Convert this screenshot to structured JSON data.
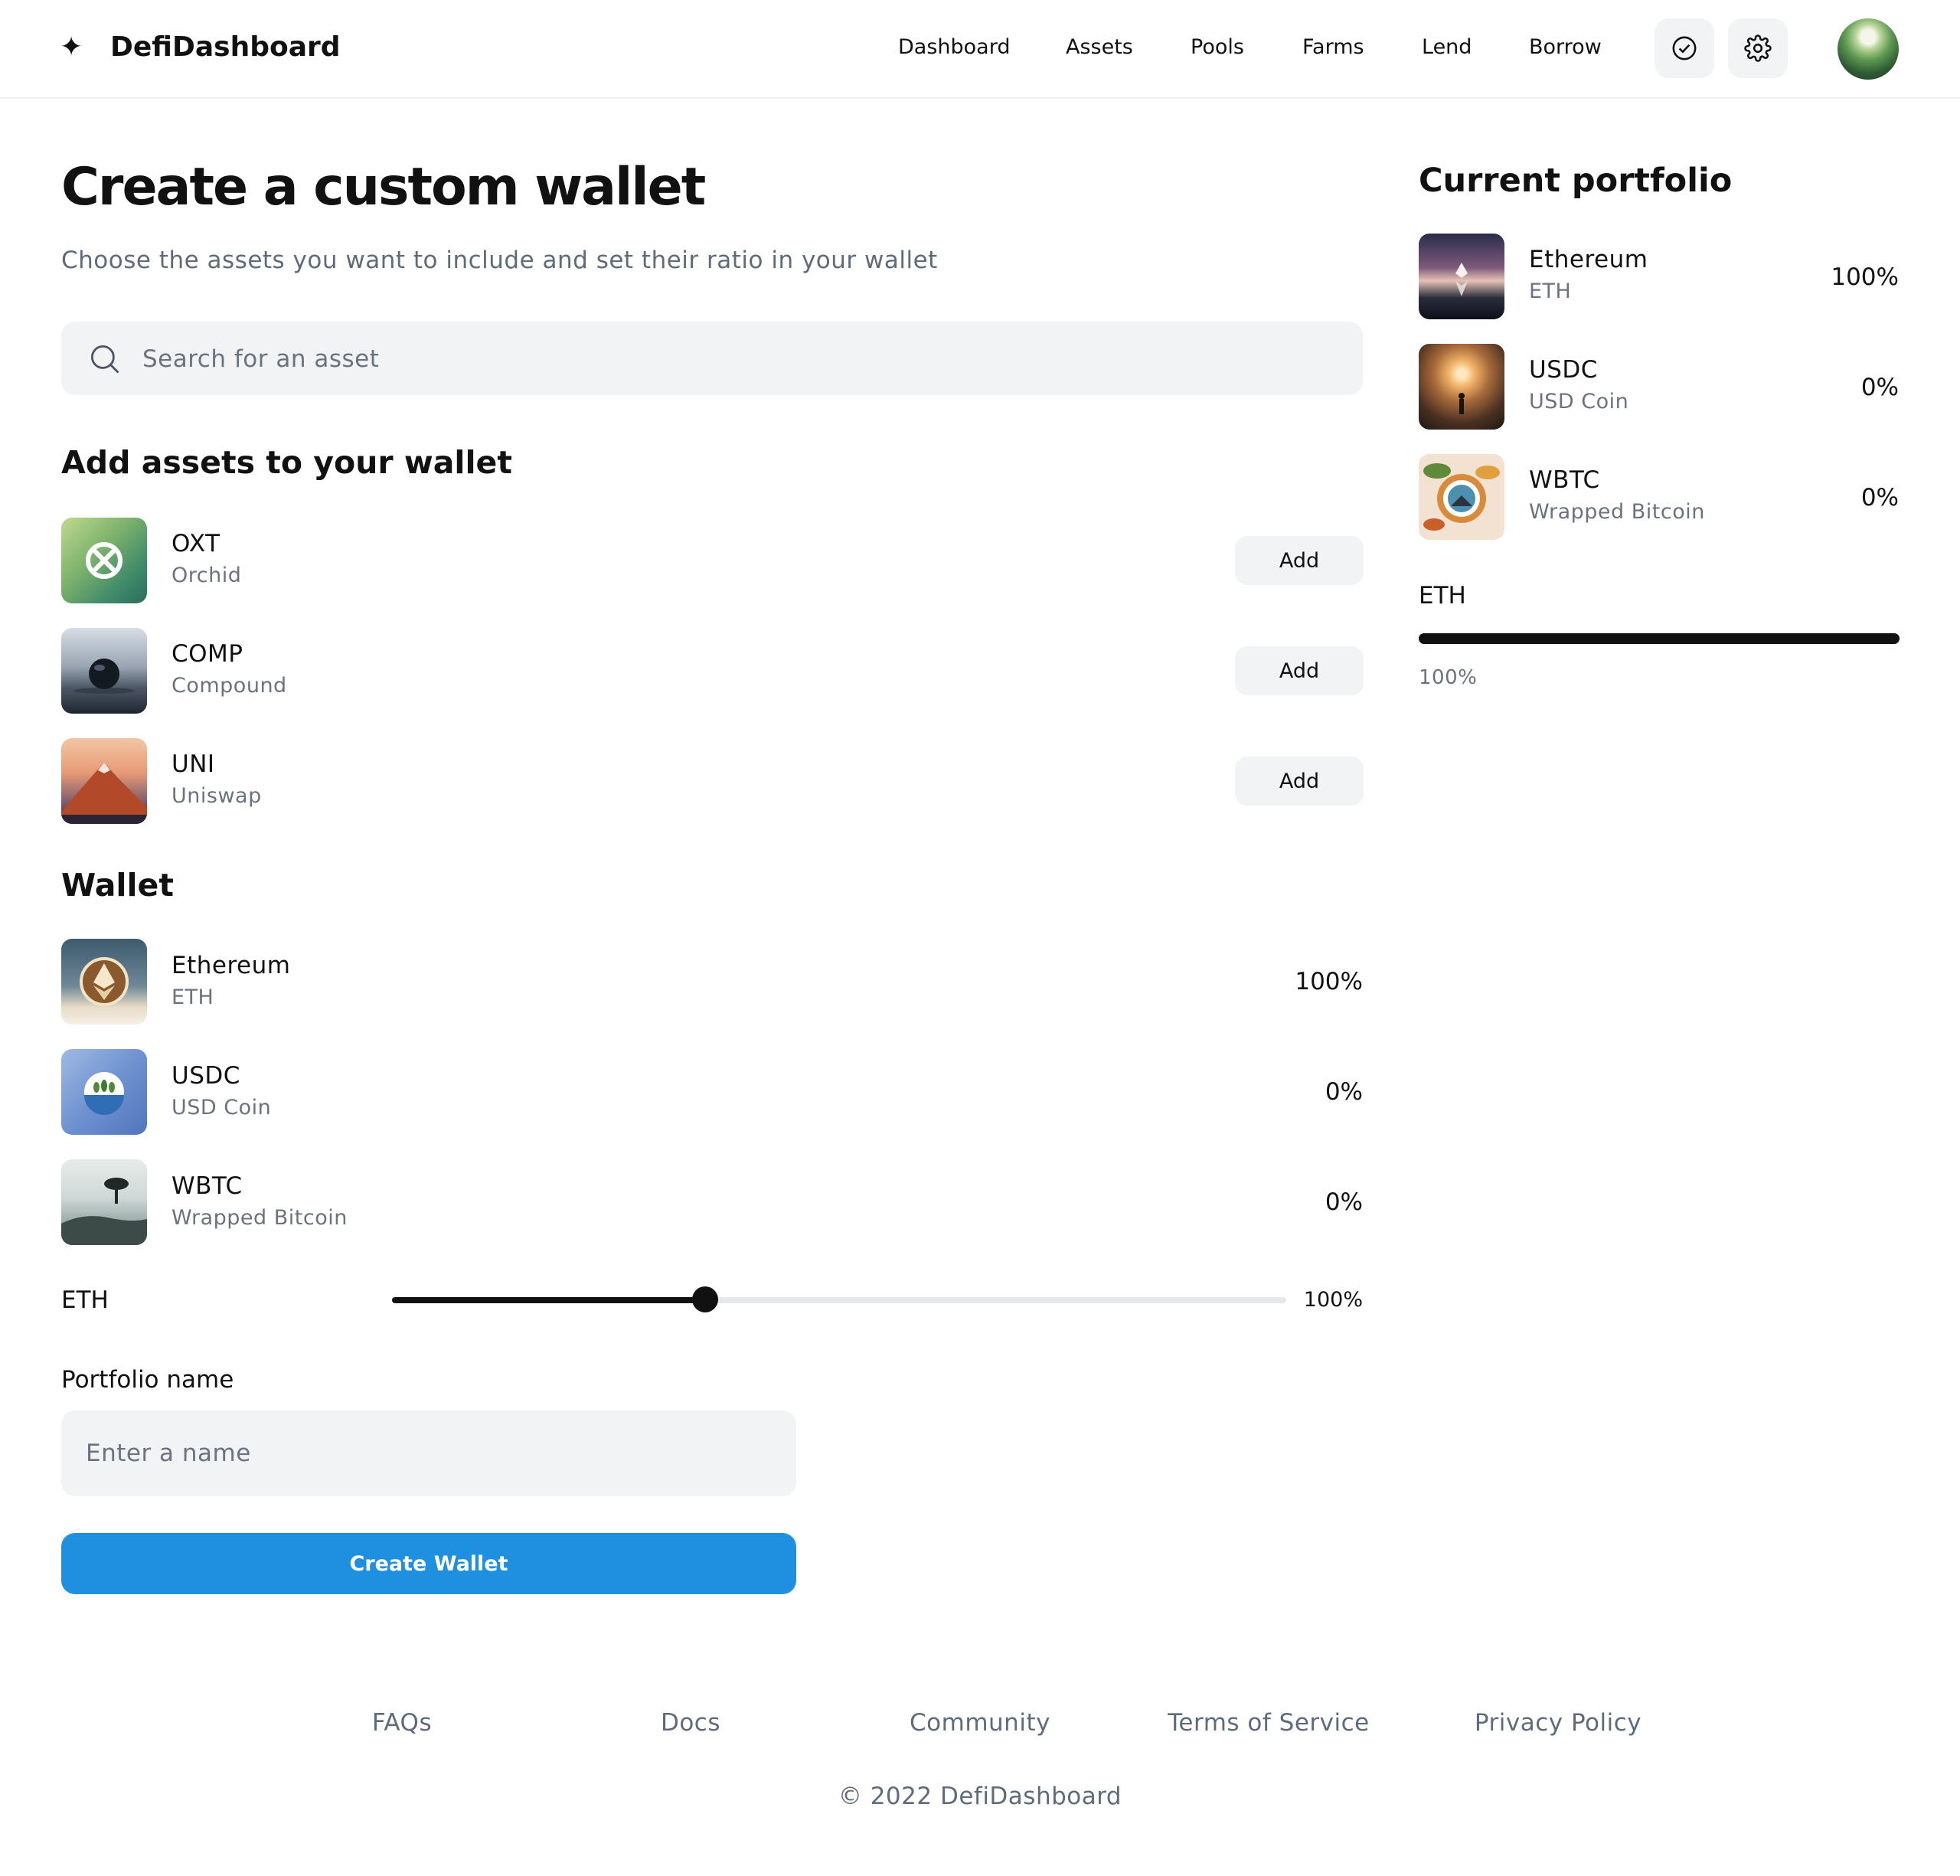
{
  "header": {
    "brand_icon": "✦",
    "brand_name": "DefiDashboard",
    "nav": [
      "Dashboard",
      "Assets",
      "Pools",
      "Farms",
      "Lend",
      "Borrow"
    ],
    "icons": [
      "check-circle-icon",
      "gear-icon"
    ]
  },
  "main": {
    "title": "Create a custom wallet",
    "subtitle": "Choose the assets you want to include and set their ratio in your wallet",
    "search": {
      "placeholder": "Search for an asset",
      "value": ""
    },
    "add_section_title": "Add assets to your wallet",
    "available_assets": [
      {
        "symbol": "OXT",
        "name": "Orchid",
        "button": "Add"
      },
      {
        "symbol": "COMP",
        "name": "Compound",
        "button": "Add"
      },
      {
        "symbol": "UNI",
        "name": "Uniswap",
        "button": "Add"
      }
    ],
    "wallet_title": "Wallet",
    "wallet_assets": [
      {
        "name": "Ethereum",
        "symbol": "ETH",
        "pct": "100%"
      },
      {
        "name": "USDC",
        "symbol": "USD Coin",
        "pct": "0%"
      },
      {
        "name": "WBTC",
        "symbol": "Wrapped Bitcoin",
        "pct": "0%"
      }
    ],
    "slider": {
      "label": "ETH",
      "value_text": "100%",
      "position_fraction": 0.35
    },
    "portfolio_name_label": "Portfolio name",
    "portfolio_name_placeholder": "Enter a name",
    "portfolio_name_value": "",
    "create_button": "Create Wallet",
    "accent_color": "#1f8fdf"
  },
  "sidebar": {
    "title": "Current portfolio",
    "assets": [
      {
        "name": "Ethereum",
        "symbol": "ETH",
        "pct": "100%"
      },
      {
        "name": "USDC",
        "symbol": "USD Coin",
        "pct": "0%"
      },
      {
        "name": "WBTC",
        "symbol": "Wrapped Bitcoin",
        "pct": "0%"
      }
    ],
    "allocation": {
      "label": "ETH",
      "value_text": "100%",
      "fraction": 1.0
    }
  },
  "footer": {
    "links": [
      "FAQs",
      "Docs",
      "Community",
      "Terms of Service",
      "Privacy Policy"
    ],
    "copyright": "© 2022 DefiDashboard"
  }
}
